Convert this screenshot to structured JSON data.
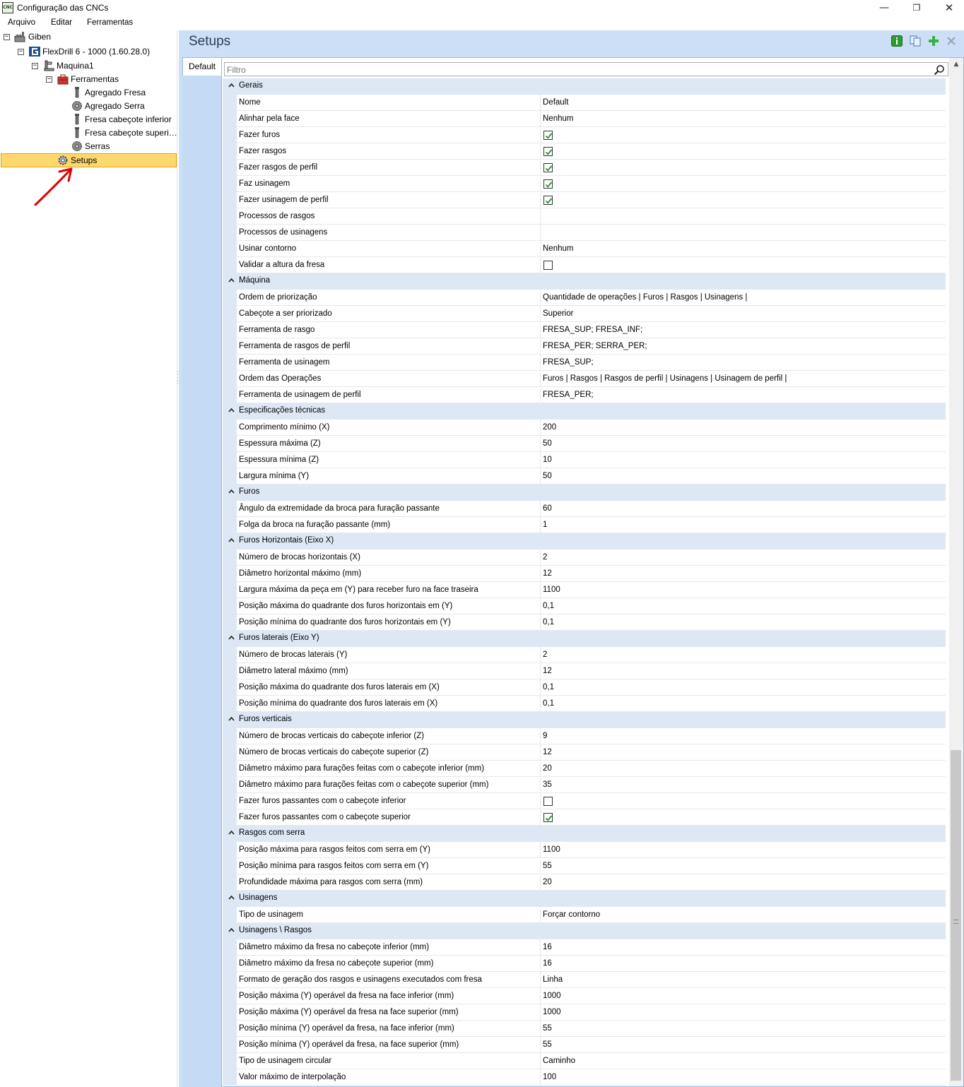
{
  "window": {
    "title": "Configuração das CNCs",
    "icon_text": "CNC",
    "controls": {
      "minimize": "—",
      "maximize": "❐",
      "close": "✕"
    }
  },
  "menu": {
    "arquivo": "Arquivo",
    "editar": "Editar",
    "ferramentas": "Ferramentas"
  },
  "tree": {
    "root": "Giben",
    "machine_model": "FlexDrill 6 - 1000 (1.60.28.0)",
    "machine": "Maquina1",
    "tools_folder": "Ferramentas",
    "tools": [
      "Agregado Fresa",
      "Agregado Serra",
      "Fresa cabeçote inferior",
      "Fresa cabeçote superi…",
      "Serras"
    ],
    "setups": "Setups"
  },
  "content": {
    "title": "Setups",
    "tab": "Default",
    "filter_placeholder": "Filtro"
  },
  "categories": [
    {
      "name": "Gerais",
      "rows": [
        {
          "name": "Nome",
          "value": "Default"
        },
        {
          "name": "Alinhar pela face",
          "value": "Nenhum"
        },
        {
          "name": "Fazer furos",
          "check": true
        },
        {
          "name": "Fazer rasgos",
          "check": true
        },
        {
          "name": "Fazer rasgos de perfil",
          "check": true
        },
        {
          "name": "Faz usinagem",
          "check": true
        },
        {
          "name": "Fazer usinagem de perfil",
          "check": true
        },
        {
          "name": "Processos de rasgos",
          "value": ""
        },
        {
          "name": "Processos de usinagens",
          "value": ""
        },
        {
          "name": "Usinar contorno",
          "value": "Nenhum"
        },
        {
          "name": "Validar a altura da fresa",
          "check": false
        }
      ]
    },
    {
      "name": "Máquina",
      "rows": [
        {
          "name": "Ordem de priorização",
          "value": "Quantidade de operações | Furos | Rasgos | Usinagens |"
        },
        {
          "name": "Cabeçote a ser priorizado",
          "value": "Superior"
        },
        {
          "name": "Ferramenta de rasgo",
          "value": "FRESA_SUP; FRESA_INF;"
        },
        {
          "name": "Ferramenta de rasgos de perfil",
          "value": "FRESA_PER; SERRA_PER;"
        },
        {
          "name": "Ferramenta de usinagem",
          "value": "FRESA_SUP;"
        },
        {
          "name": "Ordem das Operações",
          "value": "Furos | Rasgos | Rasgos de perfil | Usinagens | Usinagem de perfil |"
        },
        {
          "name": "Ferramenta de usinagem de perfil",
          "value": "FRESA_PER;"
        }
      ]
    },
    {
      "name": "Especificações técnicas",
      "rows": [
        {
          "name": "Comprimento mínimo (X)",
          "value": "200"
        },
        {
          "name": "Espessura máxima (Z)",
          "value": "50"
        },
        {
          "name": "Espessura mínima (Z)",
          "value": "10"
        },
        {
          "name": "Largura mínima (Y)",
          "value": "50"
        }
      ]
    },
    {
      "name": "Furos",
      "rows": [
        {
          "name": "Ângulo da extremidade da broca para furação passante",
          "value": "60"
        },
        {
          "name": "Folga da broca na furação passante (mm)",
          "value": "1"
        }
      ]
    },
    {
      "name": "Furos Horizontais (Eixo X)",
      "rows": [
        {
          "name": "Número de brocas horizontais (X)",
          "value": "2"
        },
        {
          "name": "Diâmetro horizontal máximo (mm)",
          "value": "12"
        },
        {
          "name": "Largura máxima da peça em (Y) para receber furo na face traseira",
          "value": "1100"
        },
        {
          "name": "Posição máxima do quadrante dos furos horizontais em (Y)",
          "value": "0,1"
        },
        {
          "name": "Posição mínima do quadrante dos furos horizontais em (Y)",
          "value": "0,1"
        }
      ]
    },
    {
      "name": "Furos laterais (Eixo Y)",
      "rows": [
        {
          "name": "Número de brocas laterais (Y)",
          "value": "2"
        },
        {
          "name": "Diâmetro lateral máximo (mm)",
          "value": "12"
        },
        {
          "name": "Posição máxima do quadrante dos furos laterais em (X)",
          "value": "0,1"
        },
        {
          "name": "Posição mínima do quadrante dos furos laterais em (X)",
          "value": "0,1"
        }
      ]
    },
    {
      "name": "Furos verticais",
      "rows": [
        {
          "name": "Número de brocas verticais do cabeçote inferior (Z)",
          "value": "9"
        },
        {
          "name": "Número de brocas verticais do cabeçote superior (Z)",
          "value": "12"
        },
        {
          "name": "Diâmetro máximo para furações feitas com o cabeçote inferior (mm)",
          "value": "20"
        },
        {
          "name": "Diâmetro máximo para furações feitas com o cabeçote superior (mm)",
          "value": "35"
        },
        {
          "name": "Fazer furos passantes com o cabeçote inferior",
          "check": false
        },
        {
          "name": "Fazer furos passantes com o cabeçote superior",
          "check": true
        }
      ]
    },
    {
      "name": "Rasgos com serra",
      "rows": [
        {
          "name": "Posição máxima para rasgos feitos com serra em (Y)",
          "value": "1100"
        },
        {
          "name": "Posição mínima para rasgos feitos com serra em (Y)",
          "value": "55"
        },
        {
          "name": "Profundidade máxima para rasgos com serra (mm)",
          "value": "20"
        }
      ]
    },
    {
      "name": "Usinagens",
      "rows": [
        {
          "name": "Tipo de usinagem",
          "value": "Forçar contorno"
        }
      ]
    },
    {
      "name": "Usinagens \\ Rasgos",
      "rows": [
        {
          "name": "Diâmetro máximo da fresa no cabeçote inferior (mm)",
          "value": "16"
        },
        {
          "name": "Diâmetro máximo da fresa no cabeçote superior (mm)",
          "value": "16"
        },
        {
          "name": "Formato de geração dos rasgos e usinagens executados com fresa",
          "value": "Linha"
        },
        {
          "name": "Posição máxima (Y) operável da fresa na face inferior (mm)",
          "value": "1000"
        },
        {
          "name": "Posição máxima (Y) operável da fresa na face superior (mm)",
          "value": "1000"
        },
        {
          "name": "Posição mínima (Y) operável da fresa, na face inferior (mm)",
          "value": "55"
        },
        {
          "name": "Posição mínima (Y) operável da fresa, na face superior (mm)",
          "value": "55"
        },
        {
          "name": "Tipo de usinagem circular",
          "value": "Caminho"
        },
        {
          "name": "Valor máximo de interpolação",
          "value": "100"
        }
      ]
    }
  ],
  "colors": {
    "accent_selection": "#fcd86e",
    "panel_bg": "#ccdff6",
    "category_bg": "#dee8f5",
    "check_mark": "#2e8b2e",
    "annotation_arrow": "#e00000"
  },
  "icons": {
    "header_buttons": [
      "info-icon",
      "copy-icon",
      "add-icon",
      "delete-icon"
    ],
    "filter": "search-icon"
  }
}
